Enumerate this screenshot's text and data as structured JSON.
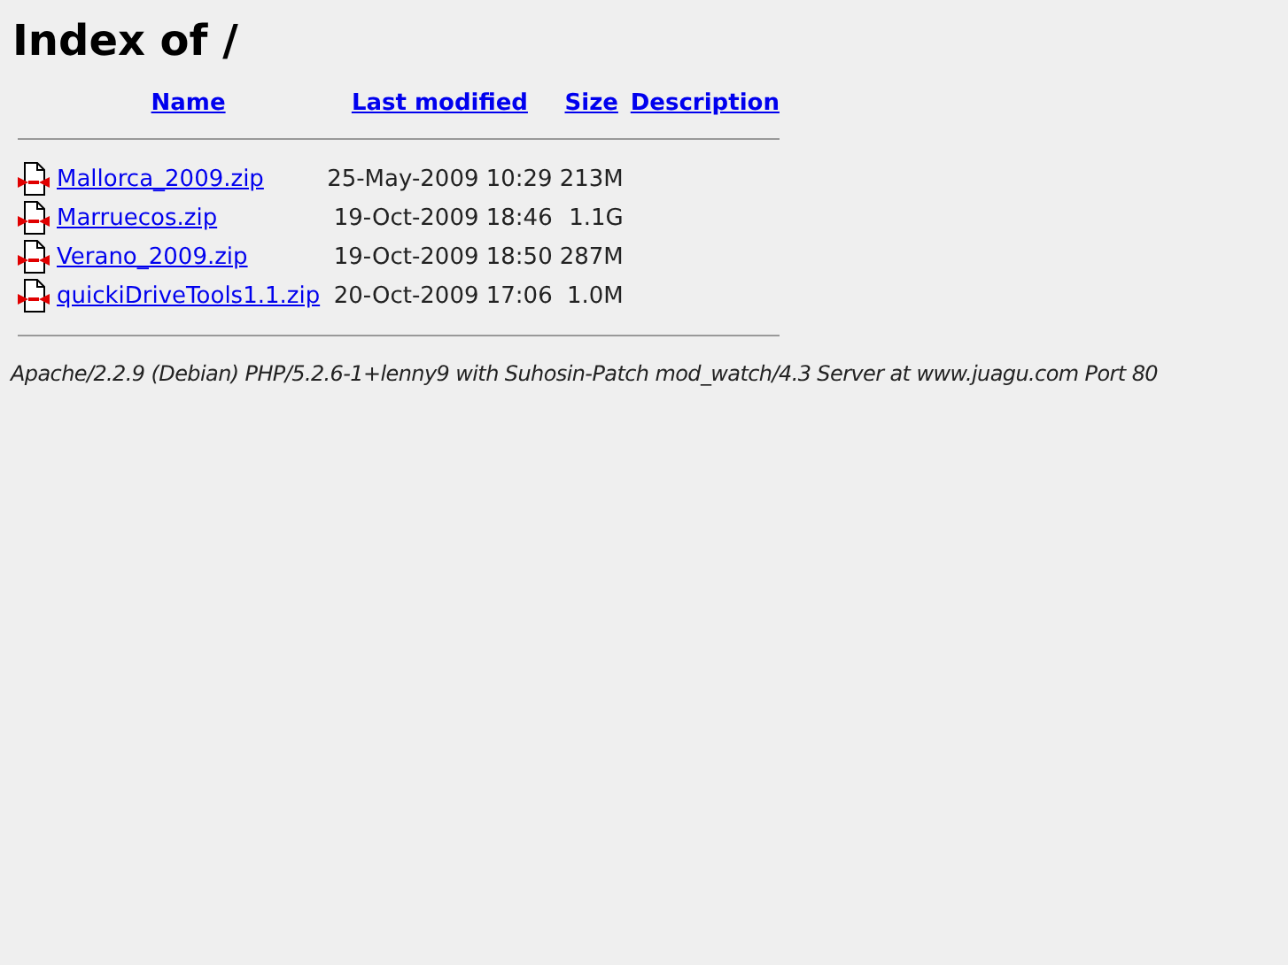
{
  "title": "Index of /",
  "columns": [
    "Name",
    "Last modified",
    "Size",
    "Description"
  ],
  "rows": [
    {
      "name": "Mallorca_2009.zip",
      "modified": "25-May-2009 10:29",
      "size": "213M"
    },
    {
      "name": "Marruecos.zip",
      "modified": "19-Oct-2009 18:46",
      "size": "1.1G"
    },
    {
      "name": "Verano_2009.zip",
      "modified": "19-Oct-2009 18:50",
      "size": "287M"
    },
    {
      "name": "quickiDriveTools1.1.zip",
      "modified": "20-Oct-2009 17:06",
      "size": "1.0M"
    }
  ],
  "footer": "Apache/2.2.9 (Debian) PHP/5.2.6-1+lenny9 with Suhosin-Patch mod_watch/4.3 Server at www.juagu.com Port 80"
}
